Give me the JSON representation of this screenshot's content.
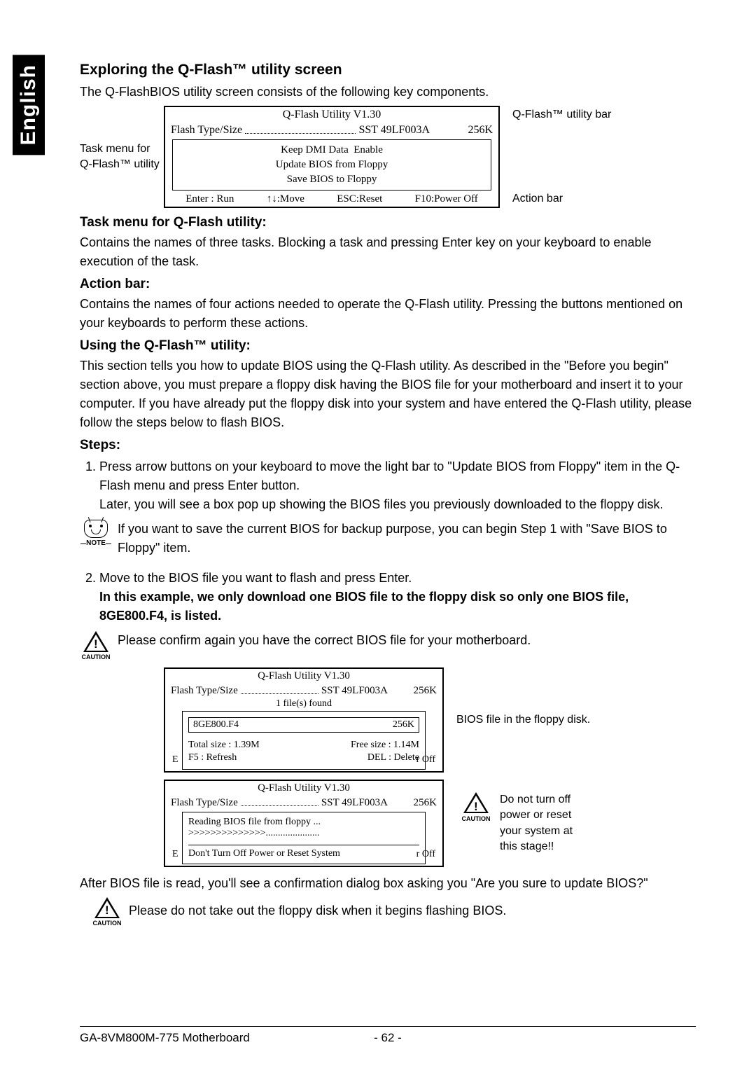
{
  "sideTab": "English",
  "h1": "Exploring the Q-Flash™ utility screen",
  "intro": "The Q-FlashBIOS utility screen consists of the following key components.",
  "diag1": {
    "leftLabel1": "Task menu for",
    "leftLabel2": "Q-Flash™ utility",
    "title": "Q-Flash Utility V1.30",
    "flashLabel": "Flash Type/Size",
    "flashValue": "SST 49LF003A",
    "flashSize": "256K",
    "keepDmi": "Keep DMI Data",
    "keepDmiVal": "Enable",
    "updateBios": "Update BIOS from Floppy",
    "saveBios": "Save BIOS to Floppy",
    "actEnter": "Enter : Run",
    "actMove": "↑↓:Move",
    "actEsc": "ESC:Reset",
    "actF10": "F10:Power Off",
    "rightLabel1": "Q-Flash™ utility bar",
    "rightLabel2": "Action bar"
  },
  "h2a": "Task menu for Q-Flash utility:",
  "p2a": "Contains the names of three tasks. Blocking a task and pressing Enter key on your keyboard to enable execution of the task.",
  "h2b": "Action bar:",
  "p2b": "Contains the names of four actions needed to operate the Q-Flash utility. Pressing the buttons mentioned on your keyboards to perform these actions.",
  "h2c": "Using the Q-Flash™ utility:",
  "p2c": "This section tells you how to update BIOS using the Q-Flash utility. As described in the \"Before you begin\" section above, you must prepare a floppy disk having the BIOS file for your motherboard and insert it to your computer. If you have already put the floppy disk into your system and have entered the Q-Flash utility, please follow the steps below to flash BIOS.",
  "h2d": "Steps:",
  "step1a": "Press arrow buttons on your keyboard to move the light bar to \"Update BIOS from Floppy\" item in the Q-Flash menu and press Enter button.",
  "step1b": "Later, you will see a box pop up showing the BIOS files you previously downloaded to the floppy disk.",
  "note1": "If you want to save the current BIOS for backup purpose, you can begin Step 1 with \"Save BIOS to Floppy\" item.",
  "noteTag": "NOTE",
  "step2a": "Move to the BIOS file you want to flash and press Enter.",
  "step2b": "In this example, we only download one BIOS file to the floppy disk so only one BIOS file, 8GE800.F4, is listed.",
  "caution1": "Please confirm again you have the correct BIOS file for your motherboard.",
  "cautionTag": "CAUTION",
  "diag2": {
    "title": "Q-Flash Utility V1.30",
    "flashLabel": "Flash Type/Size",
    "flashValue": "SST 49LF003A",
    "flashSize": "256K",
    "filesFound": "1 file(s) found",
    "fileName": "8GE800.F4",
    "fileSize": "256K",
    "totalSize": "Total size : 1.39M",
    "freeSize": "Free size : 1.14M",
    "f5": "F5 : Refresh",
    "del": "DEL : Delete",
    "leftEdge": "E",
    "rightEdge": "r Off",
    "rightLabel": "BIOS file in the floppy disk."
  },
  "diag3": {
    "title": "Q-Flash Utility V1.30",
    "flashLabel": "Flash Type/Size",
    "flashValue": "SST 49LF003A",
    "flashSize": "256K",
    "reading": "Reading BIOS file from floppy ...",
    "chevrons": ">>>>>>>>>>>>>>......................",
    "warn": "Don't Turn Off Power or Reset System",
    "leftEdge": "E",
    "rightEdge": "r Off",
    "rightLabel": "Do not turn off power or reset your system at this stage!!"
  },
  "after": "After BIOS file is read, you'll see a confirmation dialog box asking you \"Are you sure to update BIOS?\"",
  "caution2": "Please do not take out the floppy disk when it begins flashing BIOS.",
  "footer": {
    "left": "GA-8VM800M-775 Motherboard",
    "page": "- 62 -"
  }
}
